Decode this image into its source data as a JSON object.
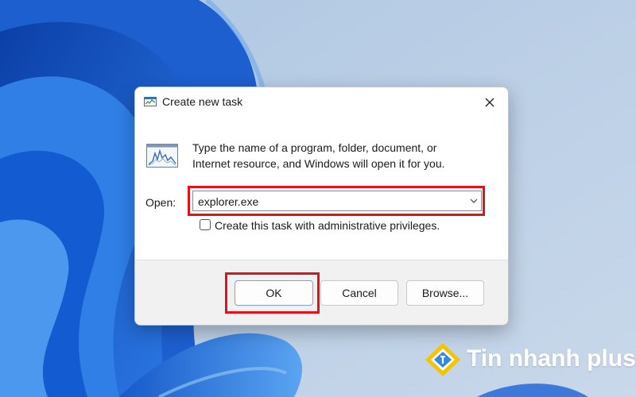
{
  "dialog": {
    "title": "Create new task",
    "description_line1": "Type the name of a program, folder, document, or",
    "description_line2": "Internet resource, and Windows will open it for you.",
    "open_label": "Open:",
    "open_value": "explorer.exe",
    "admin_checkbox_label": "Create this task with administrative privileges.",
    "admin_checkbox_checked": false,
    "buttons": {
      "ok": "OK",
      "cancel": "Cancel",
      "browse": "Browse..."
    }
  },
  "watermark": {
    "text": "Tin nhanh plus"
  },
  "colors": {
    "highlight": "#e0131b",
    "wallpaper_blue": "#1f63d1",
    "wallpaper_bg": "#b9cde3"
  }
}
